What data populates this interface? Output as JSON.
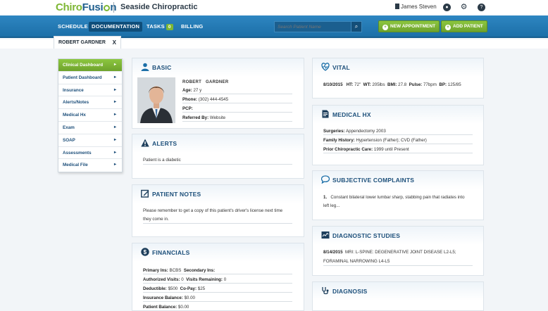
{
  "brand": {
    "logo_part1": "Chiro",
    "logo_part2": "Fusi",
    "logo_part3": "n",
    "practice": "Seaside Chiropractic",
    "user": "James Steven"
  },
  "nav": {
    "schedule": "SCHEDULE",
    "documentation": "DOCUMENTATION",
    "tasks": "TASKS",
    "tasks_count": "0",
    "billing": "BILLING",
    "search_placeholder": "Search Patient Name",
    "new_appointment": "NEW APPOINTMENT",
    "add_patient": "ADD PATIENT"
  },
  "patient_tab": {
    "name": "ROBERT GARDNER",
    "close": "X"
  },
  "sidebar": {
    "items": [
      {
        "label": "Clinical Dashboard"
      },
      {
        "label": "Patient Dashboard"
      },
      {
        "label": "Insurance"
      },
      {
        "label": "Alerts/Notes"
      },
      {
        "label": "Medical Hx"
      },
      {
        "label": "Exam"
      },
      {
        "label": "SOAP"
      },
      {
        "label": "Assessments"
      },
      {
        "label": "Medical File"
      }
    ]
  },
  "basic": {
    "title": "BASIC",
    "first_name": "ROBERT",
    "last_name": "GARDNER",
    "age_label": "Age:",
    "age": "27 y",
    "phone_label": "Phone:",
    "phone": "(302) 444-4545",
    "pcp_label": "PCP:",
    "pcp": "",
    "referred_label": "Referred By:",
    "referred": "Website"
  },
  "alerts": {
    "title": "ALERTS",
    "text": "Patient is a diabetic"
  },
  "patient_notes": {
    "title": "PATIENT NOTES",
    "line1": "Please remember to get a copy of this patient's driver's license next time",
    "line2": "they come in."
  },
  "financials": {
    "title": "FINANCIALS",
    "primary_ins_label": "Primary Ins:",
    "primary_ins": "BCBS",
    "secondary_ins_label": "Secondary Ins:",
    "secondary_ins": "",
    "auth_visits_label": "Authorized Visits:",
    "auth_visits": "0",
    "visits_remaining_label": "Visits Remaining:",
    "visits_remaining": "0",
    "deductible_label": "Deductible:",
    "deductible": "$500",
    "copay_label": "Co-Pay:",
    "copay": "$25",
    "ins_balance_label": "Insurance Balance:",
    "ins_balance": "$0.00",
    "patient_balance_label": "Patient Balance:",
    "patient_balance": "$0.00"
  },
  "vital": {
    "title": "VITAL",
    "date": "8/10/2015",
    "ht_label": "HT:",
    "ht": "72\"",
    "wt_label": "WT:",
    "wt": "205lbs",
    "bmi_label": "BMI:",
    "bmi": "27.8",
    "pulse_label": "Pulse:",
    "pulse": "77bpm",
    "bp_label": "BP:",
    "bp": "125/85"
  },
  "medical_hx": {
    "title": "MEDICAL HX",
    "surgeries_label": "Surgeries:",
    "surgeries": "Appendectomy 2003",
    "family_label": "Family History:",
    "family": "Hypertension (Father); CVD (Father)",
    "prior_label": "Prior Chiropractic Care:",
    "prior": "1999 until Present"
  },
  "subjective": {
    "title": "SUBJECTIVE COMPLAINTS",
    "num": "1.",
    "line1": "Constant bilateral lower lumbar sharp, stabbing pain that radiates into",
    "line2": "left leg..."
  },
  "diagnostic": {
    "title": "DIAGNOSTIC STUDIES",
    "date": "8/14/2015",
    "line1": "MRI: L-SPINE: DEGENERATIVE JOINT DISEASE L2-L5;",
    "line2": "FORAMINAL NARROWING L4-L5"
  },
  "diagnosis": {
    "title": "DIAGNOSIS"
  },
  "colors": {
    "nav_blue": "#1c6fa8",
    "accent_green": "#7eb734",
    "heading_blue": "#1c4f7a"
  }
}
